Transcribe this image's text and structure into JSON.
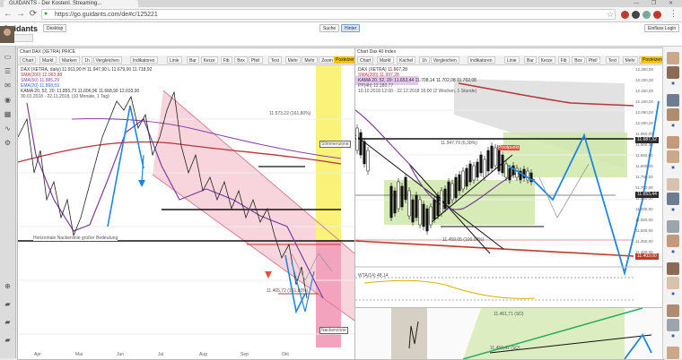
{
  "browser": {
    "tab_title": "GUIDANTS - Der Kostenl. Streaming...",
    "url": "https://go.guidants.com/de#c/125221",
    "window_controls": "— ❐ ✕"
  },
  "app": {
    "logo": "Guidants",
    "header_buttons": [
      "Desktop"
    ],
    "mid_buttons": [
      "Suche",
      "Hinter"
    ],
    "user_menu": "Einfluss Login"
  },
  "left_chart": {
    "title": "Chart DAX (XETRA) PRICE",
    "toolbar": [
      "Chart",
      "Markt",
      "Marken",
      "1h",
      "Vergleichen",
      "Indikatoren",
      "Linie",
      "Bar",
      "Kerze",
      "Fib",
      "Box",
      "Pfeil",
      "Text",
      "Mehr",
      "Mehr",
      "Zoom"
    ],
    "badge": "Posteizen",
    "legend": [
      {
        "text": "DAX (XETRA, daily) 11.911,90 H 11.947,90 L 11.679,00 11.718,92",
        "color": "#333333"
      },
      {
        "text": "SMA(200) 12.063,88",
        "color": "#b5363b"
      },
      {
        "text": "SMA(50) 11.885,29",
        "color": "#8e44ad"
      },
      {
        "text": "EMA(20) 11.868,59",
        "color": "#2d6bd8"
      },
      {
        "text": "KAMA 20, 52, 20: 11.855,73 11.606,96 11.668,90 12.033,90",
        "color": "#333333"
      },
      {
        "text": "30.01.2018 - 22.11.2018, (10 Monate, 1 Tag)",
        "color": "#555555"
      }
    ],
    "annotations": {
      "fib_top": "11.573,22 (161,80%)",
      "fib_low": "11.465,72 (161,80%)",
      "support_note": "Horizontale Nackenlinie großer Bedeutung",
      "zone_top": "Stimmenzone",
      "zone_bottom": "Nackenzone"
    },
    "x_ticks": [
      "Apr",
      "Mai",
      "Jun",
      "Jul",
      "Aug",
      "Sep",
      "Okt"
    ]
  },
  "right_chart": {
    "title": "Chart Dax 40 Index",
    "toolbar": [
      "Chart",
      "Markt",
      "Kachel",
      "1h",
      "Vergleichen",
      "Indikatoren",
      "Linie",
      "Bar",
      "Kerze",
      "Fib",
      "Box",
      "Pfeil",
      "Text",
      "Mehr",
      "Mehr",
      "Zoom"
    ],
    "badge": "Posteizen",
    "legend": [
      {
        "text": "DAX (XETRA) 11.667,28",
        "color": "#333333"
      },
      {
        "text": "SMA(200) 11.997,28",
        "color": "#b5363b"
      },
      {
        "text": "KAMA 20, 52, 20: 11.653,44 11.708,14 11.702,08 11.702,08",
        "color": "#333333"
      },
      {
        "text": "PP(4h) 12.180,77",
        "color": "#555555"
      },
      {
        "text": "10.10.2018 12:00 - 22.12.2018 16:00 (2 Wochen, 1 Stunde)",
        "color": "#555555"
      }
    ],
    "annotations": {
      "fib_mid": "11.947,79 (6,30%)",
      "pivot": "Pivotpunkt",
      "low_label": "11.459,05 (100,00%)",
      "indicator": "WTA(14) 48,14",
      "sub_label_1": "11.461,71 (SD)",
      "sub_label_2": "11.459,42 (SD)"
    },
    "price_tags": [
      {
        "text": "11.687,32",
        "color": "#2b2b2b"
      },
      {
        "text": "11.653,44",
        "color": "#2b2b2b"
      },
      {
        "text": "11.403,00",
        "color": "#c0392b"
      }
    ],
    "y_ticks": [
      "12.250,00",
      "12.200,00",
      "12.150,00",
      "12.100,00",
      "12.050,00",
      "12.000,00",
      "11.950,00",
      "11.900,00",
      "11.850,00",
      "11.800,00",
      "11.750,00",
      "11.700,00",
      "11.650,00",
      "11.600,00",
      "11.550,00",
      "11.500,00",
      "11.450,00",
      "11.400,00"
    ]
  },
  "colors": {
    "channel_fill": "#f6c9d4",
    "yellow_zone": "#fbf27a",
    "pink_zone": "#f4a3be",
    "green_zone": "#cfe8a8",
    "projection": "#1f86e0",
    "sma200": "#b5363b",
    "kama": "#7b3fa0"
  }
}
